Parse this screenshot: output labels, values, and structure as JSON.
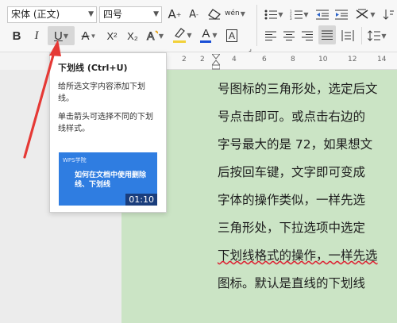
{
  "ribbon": {
    "font_name": "宋体 (正文)",
    "font_size": "四号",
    "grow_font": "A",
    "shrink_font": "A",
    "bold": "B",
    "italic": "I",
    "underline": "U",
    "strikethrough": "A",
    "superscript": "X²",
    "subscript": "X₂",
    "font_color": "A",
    "char_border": "A",
    "phonetic": "wén"
  },
  "ruler": {
    "marks": [
      "2",
      "2",
      "4",
      "6",
      "8",
      "10",
      "12",
      "14"
    ]
  },
  "tooltip": {
    "title": "下划线 (Ctrl+U)",
    "desc1": "给所选文字内容添加下划线。",
    "desc2": "单击箭头可选择不同的下划线样式。",
    "thumb_logo": "WPS学院",
    "thumb_title": "如何在文档中使用删除线、下划线",
    "thumb_duration": "01:10"
  },
  "document": {
    "lines": [
      "号图标的三角形处，选定后文",
      "号点击即可。或点击右边的",
      "字号最大的是 72，如果想文",
      "后按回车键，文字即可变成",
      "字体的操作类似，一样先选",
      "三角形处，下拉选项中选定",
      "下划线格式的操作，一样先选",
      "图标。默认是直线的下划线"
    ]
  },
  "colors": {
    "page_bg": "#cbe4c5",
    "accent_red": "#e53935",
    "font_color_bar": "#1a4fd6",
    "highlight_bar": "#f2d13a"
  }
}
